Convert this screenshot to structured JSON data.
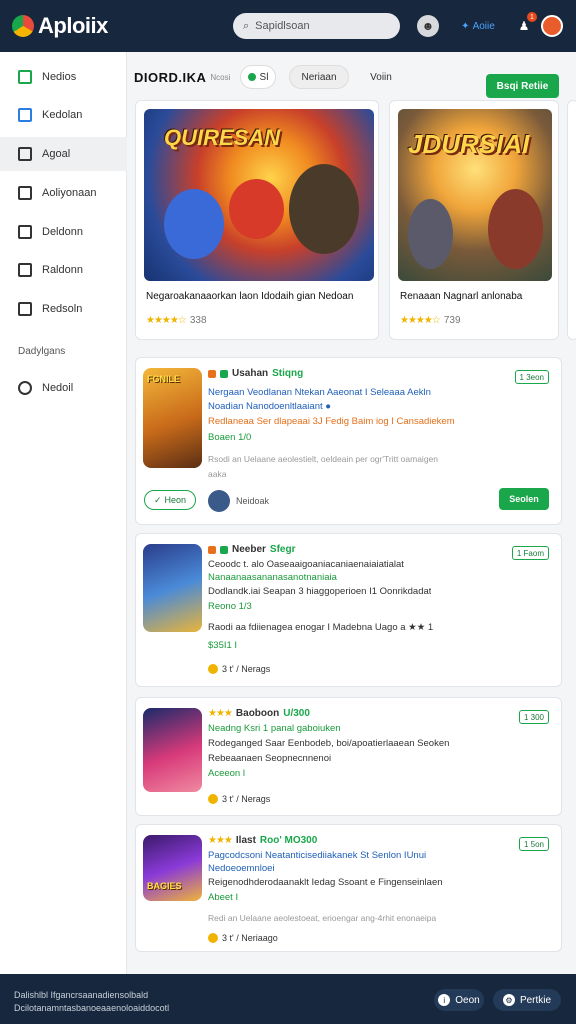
{
  "app": {
    "title": "Aploiix"
  },
  "topbar": {
    "search_placeholder": "Sapidlsoan",
    "user_label": "Aoiie",
    "notif_count": "1"
  },
  "sidebar": {
    "items": [
      {
        "label": "Nedios",
        "icon": "grid-icon"
      },
      {
        "label": "Kedolan",
        "icon": "window-icon"
      },
      {
        "label": "Agoal",
        "icon": "puzzle-icon"
      },
      {
        "label": "Aoliyonaan",
        "icon": "apps-icon"
      },
      {
        "label": "Deldonn",
        "icon": "window-icon"
      },
      {
        "label": "Raldonn",
        "icon": "lock-icon"
      },
      {
        "label": "Redsoln",
        "icon": "book-icon"
      }
    ],
    "section_heading": "Dadylgans",
    "bottom_item": {
      "label": "Nedoil",
      "icon": "clock-icon"
    }
  },
  "subbar": {
    "title": "DIORD.IKA",
    "subtitle": "Ncosi",
    "chip_1": "Sl",
    "chip_2": "Neriaan",
    "chip_3": "Voiin",
    "cta": "Bsqi Retiie"
  },
  "featured": [
    {
      "art_title": "QUIRESAN",
      "name": "Negaroakanaaorkan laon Idodaih gian Nedoan",
      "rating": "338"
    },
    {
      "art_title": "JDURSIAI",
      "name": "Renaaan Nagnarl anlonaba",
      "rating": "739"
    }
  ],
  "cards": [
    {
      "thumb_label": "FGNILE",
      "title": "Usahan",
      "title_accent": "Stiqng",
      "tag": "1 3eon",
      "lines": [
        {
          "text": "Nergaan Veodlanan Ntekan Aaeonat I Seleaaa Aekln",
          "style": "c-blue"
        },
        {
          "text": "Noadian Nanodoenltlaaiant ●",
          "style": "c-blue"
        },
        {
          "text": "Redlaneaa Ser dlapeaai 3J Fedig Baim iog I Cansadiekem",
          "style": "c-orange"
        },
        {
          "text": "Boaen 1/0",
          "style": "c-green"
        },
        {
          "text": "Rsodi an Uelaane aeolestielt, oeldeain per ogr'Tritt oamaigen",
          "style": "c-grey"
        },
        {
          "text": "aaka",
          "style": "c-grey"
        }
      ],
      "pill": "Heon",
      "author": "Neidoak",
      "button": "Seolen"
    },
    {
      "thumb_label": "",
      "title": "Neeber",
      "title_accent": "Sfegr",
      "tag": "1 Faom",
      "lines": [
        {
          "text": "Ceoodc t. alo Oaseaaigoaniacaniaenaiaiatialat",
          "style": "c-dark"
        },
        {
          "text": "Nanaanaasananasanotnaniaia",
          "style": "c-green"
        },
        {
          "text": "Dodlandk.iai Seapan 3 hiaggoperioen I1 Oonrikdadat",
          "style": "c-dark"
        },
        {
          "text": "Reono 1/3",
          "style": "c-green"
        },
        {
          "text": "Raodi aa fdiienagea enogar I Madebna Uago a ★★ 1",
          "style": "c-dark"
        },
        {
          "text": "$35I1 I",
          "style": "c-green"
        }
      ],
      "footer": "3 t'  /  Nerags"
    },
    {
      "thumb_label": "",
      "title": "Baoboon",
      "title_accent": "U/300",
      "tag": "1 300",
      "lines": [
        {
          "text": "Neadng Ksri 1 panal gaboiuken",
          "style": "c-green"
        },
        {
          "text": "Rodeganged Saar Eenbodeb, boi/apoatierlaaean Seoken",
          "style": "c-dark"
        },
        {
          "text": "Rebeaanaen Seopnecnnenoi",
          "style": "c-dark"
        },
        {
          "text": "Aceeon l",
          "style": "c-green"
        }
      ],
      "footer": "3 t'  /  Nerags"
    },
    {
      "thumb_label": "BAGIES",
      "title": "Ilast",
      "title_accent": "Roo' MO300",
      "tag": "1 5on",
      "lines": [
        {
          "text": "Pagcodcsoni Neatanticisediiakanek St Senlon IUnui",
          "style": "c-blue"
        },
        {
          "text": "Nedoeoemnloei",
          "style": "c-blue"
        },
        {
          "text": "Reigenodhderodaanaklt Iedag Ssoant e Fingenseinlaen",
          "style": "c-dark"
        },
        {
          "text": "Abeet I",
          "style": "c-green"
        },
        {
          "text": "Redi an Uelaane aeolestoeat, erioengar ang-4rhit enonaeipa",
          "style": "c-grey"
        }
      ],
      "footer": "3 t'  /  Neriaago"
    }
  ],
  "footer": {
    "line_1": "Dalishlbl Ifgancrsaanadiensolbald",
    "line_2": "Dcilotanamntasbanoeaaenoloaiddocotl",
    "btn_1": "Oeon",
    "btn_2": "Pertkie"
  },
  "colors": {
    "nav_bg": "#17273d",
    "accent": "#1aa64a",
    "star": "#f0b400"
  }
}
